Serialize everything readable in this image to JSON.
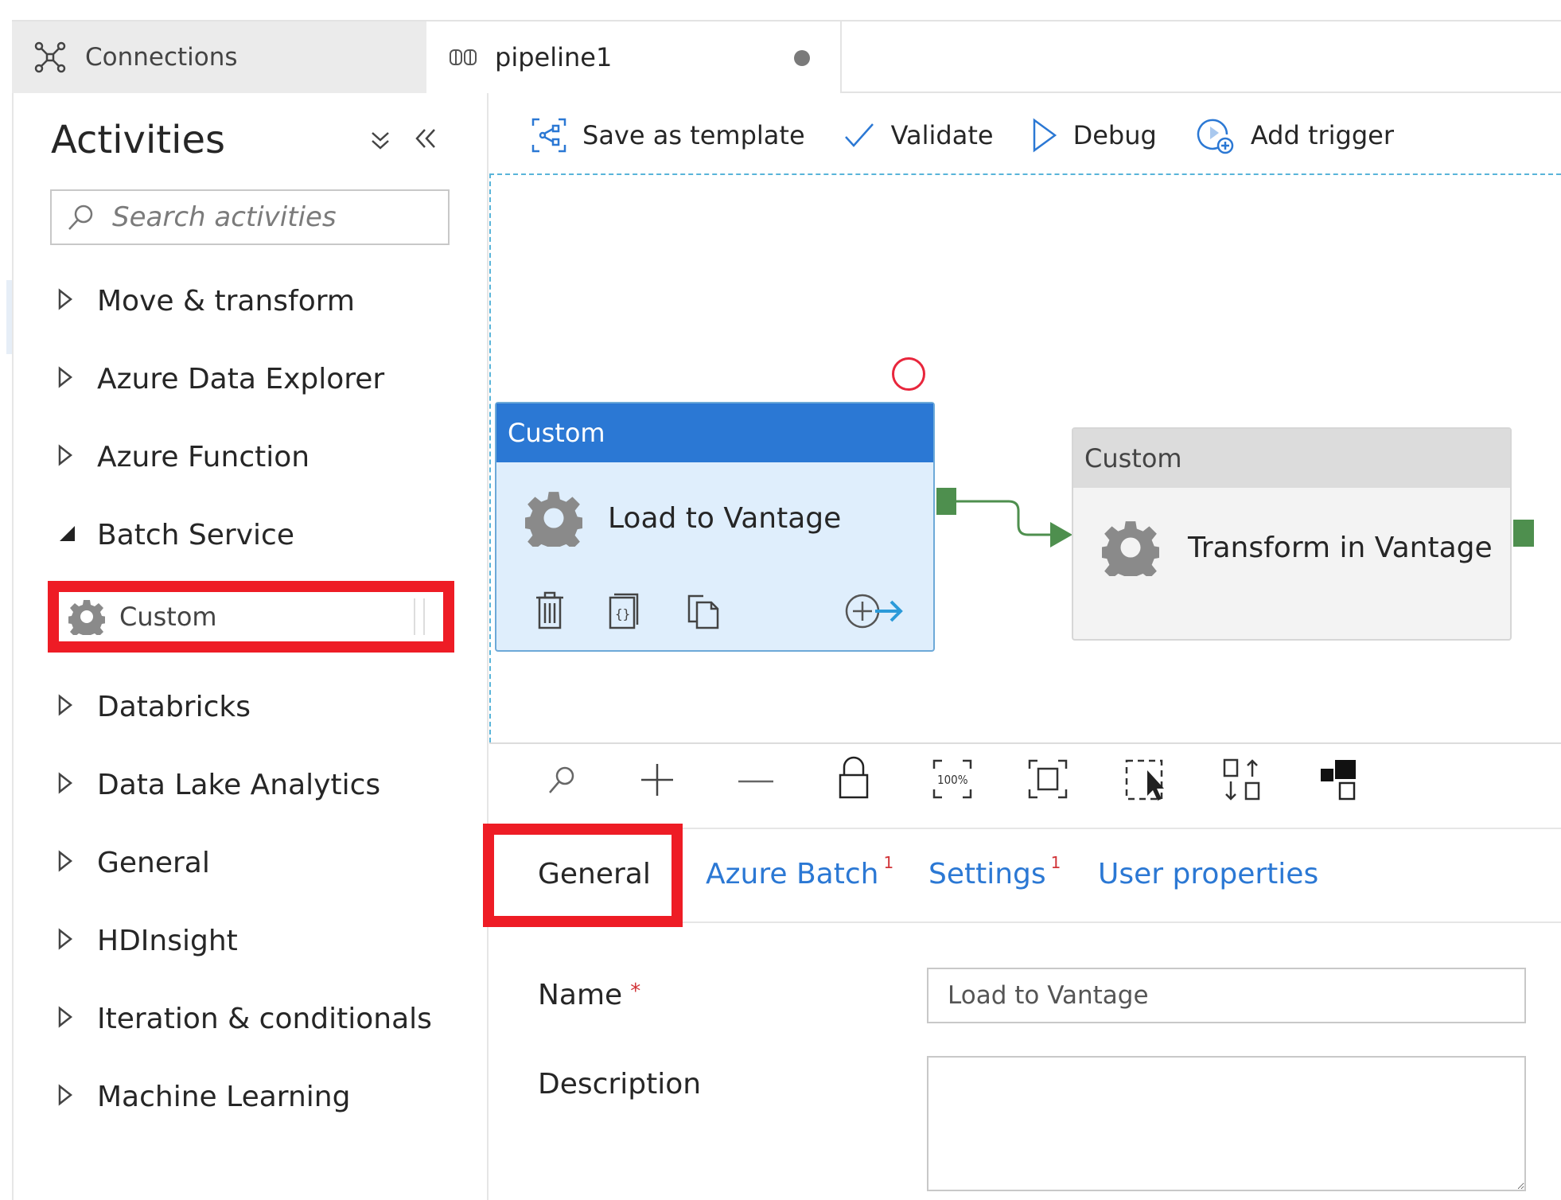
{
  "tabs": [
    {
      "label": "Connections",
      "icon": "connections-icon",
      "active": false
    },
    {
      "label": "pipeline1",
      "icon": "pipeline-icon",
      "active": true,
      "unsaved": true
    }
  ],
  "sidebar": {
    "title": "Activities",
    "collapse_all_icon": "double-chevron-down-icon",
    "hide_icon": "double-chevron-left-icon",
    "search": {
      "placeholder": "Search activities",
      "value": ""
    },
    "categories": [
      {
        "label": "Move & transform",
        "expanded": false
      },
      {
        "label": "Azure Data Explorer",
        "expanded": false
      },
      {
        "label": "Azure Function",
        "expanded": false
      },
      {
        "label": "Batch Service",
        "expanded": true,
        "children": [
          {
            "label": "Custom",
            "icon": "gear-icon",
            "highlighted": true
          }
        ]
      },
      {
        "label": "Databricks",
        "expanded": false
      },
      {
        "label": "Data Lake Analytics",
        "expanded": false
      },
      {
        "label": "General",
        "expanded": false
      },
      {
        "label": "HDInsight",
        "expanded": false
      },
      {
        "label": "Iteration & conditionals",
        "expanded": false
      },
      {
        "label": "Machine Learning",
        "expanded": false
      }
    ]
  },
  "commandbar": {
    "save_template": "Save as template",
    "validate": "Validate",
    "debug": "Debug",
    "add_trigger": "Add trigger"
  },
  "canvas": {
    "nodes": [
      {
        "type": "Custom",
        "name": "Load to Vantage",
        "selected": true
      },
      {
        "type": "Custom",
        "name": "Transform in Vantage",
        "selected": false
      }
    ],
    "connection": {
      "from": "Load to Vantage",
      "to": "Transform in Vantage",
      "condition": "success"
    },
    "node_actions": [
      "delete-icon",
      "code-icon",
      "copy-icon",
      "add-output-icon"
    ],
    "toolbar": [
      "search-icon",
      "zoom-in-icon",
      "zoom-out-icon",
      "lock-icon",
      "zoom-100-icon",
      "fit-to-screen-icon",
      "select-icon",
      "auto-align-icon",
      "layout-icon"
    ]
  },
  "properties": {
    "tabs": [
      {
        "label": "General",
        "active": true,
        "badge": ""
      },
      {
        "label": "Azure Batch",
        "active": false,
        "badge": "1"
      },
      {
        "label": "Settings",
        "active": false,
        "badge": "1"
      },
      {
        "label": "User properties",
        "active": false,
        "badge": ""
      }
    ],
    "name_label": "Name",
    "required_mark": "*",
    "name_value": "Load to Vantage",
    "description_label": "Description",
    "description_value": ""
  },
  "colors": {
    "accent": "#2b78d4",
    "highlight": "#ee1c25",
    "success": "#4e8f4e",
    "canvas_border": "#59b4d9"
  }
}
